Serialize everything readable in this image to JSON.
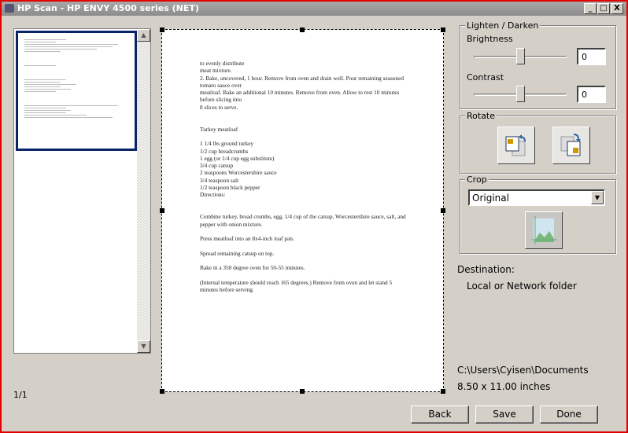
{
  "window": {
    "title": "HP Scan - HP ENVY 4500 series (NET)",
    "minimize": "_",
    "maximize": "□",
    "close": "X"
  },
  "thumbnails": {
    "page_indicator": "1/1"
  },
  "document_lines": [
    "to evenly distribute",
    "meat mixture.",
    "2. Bake, uncovered, 1 hour. Remove from oven and drain well. Pour remaining seasoned",
    "tomato sauce over",
    "meatloaf. Bake an additional 10 minutes. Remove from oven. Allow to rest 10 minutes",
    "before slicing into",
    "8 slices to serve.",
    "",
    "",
    "Turkey meatloaf",
    "",
    "1 1/4 lbs ground turkey",
    "1/2 cup breadcrumbs",
    "1 egg (or 1/4 cup egg substitute)",
    "3/4 cup catsup",
    "2 teaspoons Worcestershire sauce",
    "3/4 teaspoon salt",
    "1/2 teaspoon black pepper",
    "Directions:",
    "",
    "",
    "Combine turkey, bread crumbs, egg, 1/4 cup of the catsup, Worcestershire sauce, salt, and",
    "pepper with onion mixture.",
    "",
    "Press meatloaf into an 8x4-inch loaf pan.",
    "",
    "Spread remaining catsup on top.",
    "",
    "Bake in a 350 degree oven for 50-55 minutes.",
    "",
    "(Internal temperature should reach 165 degrees.) Remove from oven and let stand 5",
    "minutes before serving."
  ],
  "adjust": {
    "group_label": "Lighten / Darken",
    "brightness_label": "Brightness",
    "brightness_value": "0",
    "brightness_fraction": 0.5,
    "contrast_label": "Contrast",
    "contrast_value": "0",
    "contrast_fraction": 0.5
  },
  "rotate": {
    "group_label": "Rotate"
  },
  "crop": {
    "group_label": "Crop",
    "selected": "Original"
  },
  "destination": {
    "label": "Destination:",
    "value": "Local or Network folder",
    "path": "C:\\Users\\Cyisen\\Documents",
    "size": "8.50 x 11.00 inches"
  },
  "buttons": {
    "back": "Back",
    "save": "Save",
    "done": "Done"
  }
}
